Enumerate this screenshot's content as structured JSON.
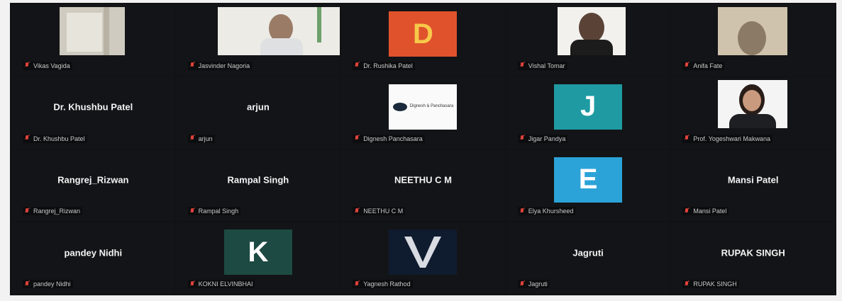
{
  "tiles": [
    {
      "label": "Vikas Vagida"
    },
    {
      "label": "Jasvinder Nagoria"
    },
    {
      "label": "Dr. Rushika Patel",
      "avatar_letter": "D",
      "avatar_color": "#e0522b"
    },
    {
      "label": "Vishal Tomar"
    },
    {
      "label": "Anifa Fate"
    },
    {
      "center": "Dr. Khushbu Patel",
      "label": "Dr. Khushbu Patel"
    },
    {
      "center": "arjun",
      "label": "arjun"
    },
    {
      "label": "Dignesh Panchasara",
      "logo_text": "Dignesh & Panchasara"
    },
    {
      "label": "Jigar Pandya",
      "avatar_letter": "J",
      "avatar_color": "#1f9aa3"
    },
    {
      "label": "Prof. Yogeshwari Makwana"
    },
    {
      "center": "Rangrej_Rizwan",
      "label": "Rangrej_Rizwan"
    },
    {
      "center": "Rampal Singh",
      "label": "Rampal Singh"
    },
    {
      "center": "NEETHU C M",
      "label": "NEETHU C M"
    },
    {
      "label": "Elya Khursheed",
      "avatar_letter": "E",
      "avatar_color": "#2ba3d8"
    },
    {
      "center": "Mansi Patel",
      "label": "Mansi Patel"
    },
    {
      "center": "pandey Nidhi",
      "label": "pandey Nidhi"
    },
    {
      "label": "KOKNI ELVINBHAI",
      "avatar_letter": "K",
      "avatar_color": "#1d4a42"
    },
    {
      "label": "Yagnesh Rathod"
    },
    {
      "center": "Jagruti",
      "label": "Jagruti"
    },
    {
      "center": "RUPAK SINGH",
      "label": "RUPAK SINGH"
    }
  ]
}
